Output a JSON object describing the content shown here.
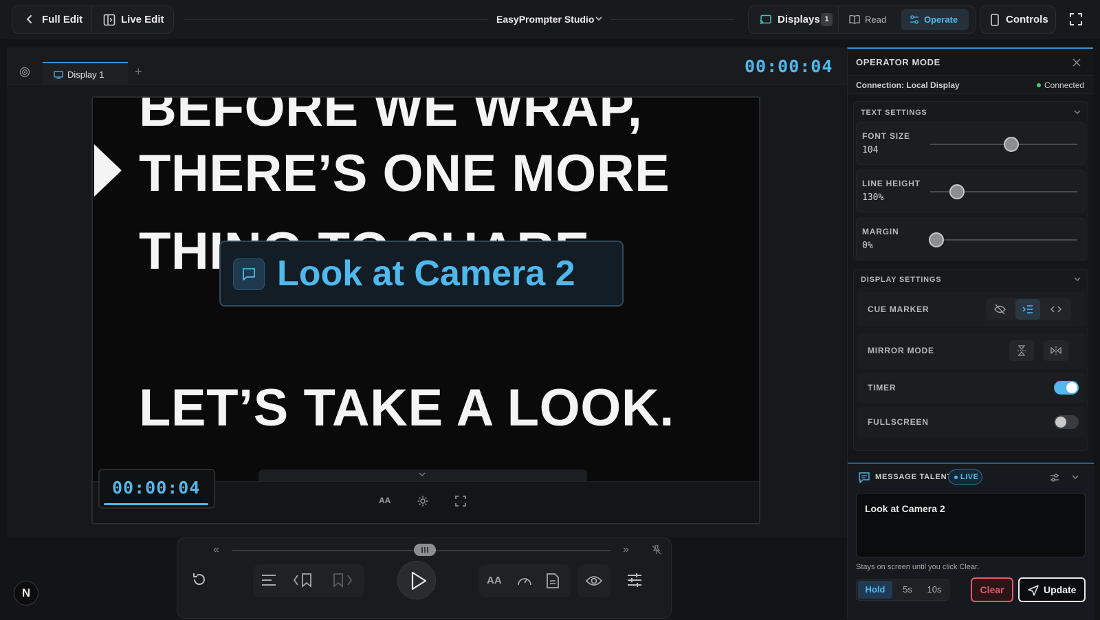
{
  "topbar": {
    "full_edit": "Full Edit",
    "live_edit": "Live Edit",
    "app_title": "EasyPrompter Studio",
    "displays_label": "Displays",
    "displays_count": "1",
    "read_label": "Read",
    "operate_label": "Operate",
    "controls_label": "Controls"
  },
  "stage": {
    "tab_label": "Display 1",
    "timer": "00:00:04",
    "prompt_lines": [
      "BEFORE WE WRAP,",
      "THERE’S ONE MORE",
      "THING TO SHARE.",
      "LET’S TAKE A LOOK."
    ],
    "overlay_message": "Look at Camera 2",
    "screen_timer": "00:00:04",
    "font_toggle": "AA"
  },
  "transport": {
    "font_label": "AA"
  },
  "panel": {
    "title": "OPERATOR MODE",
    "connection_label": "Connection: Local Display",
    "connection_status": "Connected",
    "text_settings": {
      "heading": "TEXT SETTINGS",
      "font_size_label": "FONT SIZE",
      "font_size_value": "104",
      "font_size_level": 0.55,
      "line_height_label": "LINE HEIGHT",
      "line_height_value": "130%",
      "line_height_level": 0.18,
      "margin_label": "MARGIN",
      "margin_value": "0%",
      "margin_level": 0.04
    },
    "display_settings": {
      "heading": "DISPLAY SETTINGS",
      "cue_marker_label": "CUE MARKER",
      "mirror_mode_label": "MIRROR MODE",
      "timer_label": "TIMER",
      "fullscreen_label": "FULLSCREEN"
    },
    "message": {
      "heading": "MESSAGE TALENT",
      "live_badge": "LIVE",
      "text": "Look at Camera 2",
      "hint": "Stays on screen until you click Clear.",
      "hold_label": "Hold",
      "five_label": "5s",
      "ten_label": "10s",
      "clear_label": "Clear",
      "update_label": "Update"
    }
  },
  "colors": {
    "accent": "#4fb8ec",
    "clear_red": "#e05a67",
    "connected_green": "#3ecf6e"
  },
  "brand": {
    "logo_letter": "N"
  }
}
